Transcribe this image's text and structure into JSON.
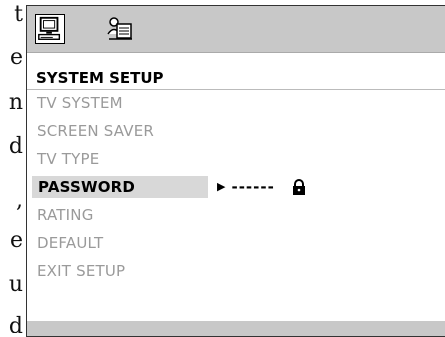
{
  "left_text": [
    "t",
    "e",
    "n",
    "d",
    ",",
    "e",
    "u",
    "d"
  ],
  "icons": {
    "active_tab": "computer-icon",
    "inactive_tab": "user-settings-icon",
    "value_lock": "lock-icon"
  },
  "setup": {
    "title": "SYSTEM  SETUP",
    "items": [
      {
        "label": "TV  SYSTEM"
      },
      {
        "label": "SCREEN  SAVER"
      },
      {
        "label": "TV  TYPE"
      },
      {
        "label": "PASSWORD"
      },
      {
        "label": "RATING"
      },
      {
        "label": "DEFAULT"
      },
      {
        "label": "EXIT  SETUP"
      }
    ],
    "selected_index": 3,
    "password_value": "------"
  },
  "colors": {
    "bar": "#c8c8c8",
    "selected_bg": "#d8d8d8",
    "inactive_text": "#9a9a9a"
  }
}
